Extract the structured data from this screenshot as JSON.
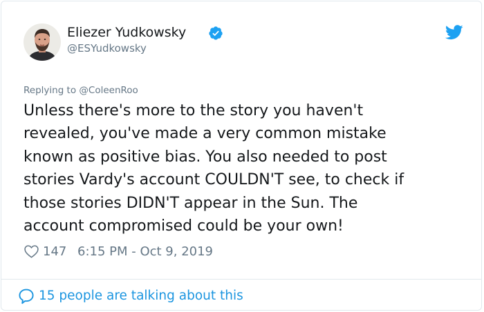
{
  "author": {
    "display_name": "Eliezer Yudkowsky",
    "handle": "@ESYudkowsky",
    "verified": true
  },
  "icons": {
    "avatar": "avatar-photo",
    "verified": "verified-badge-icon",
    "brand": "twitter-bird-icon",
    "like": "heart-icon",
    "conversation": "speech-bubble-icon"
  },
  "tweet": {
    "replying_to": "Replying to @ColeenRoo",
    "lines": [
      "Unless there's more to the story you haven't",
      "revealed, you've made a very common mistake",
      "known as positive bias.  You also needed to post",
      "stories Vardy's account COULDN'T see, to check if",
      "those stories DIDN'T appear in the Sun.  The",
      "account compromised could be your own!"
    ],
    "likes": "147",
    "timestamp": "6:15 PM - Oct 9, 2019"
  },
  "footer": {
    "talking": "15 people are talking about this"
  },
  "colors": {
    "brand_blue": "#1da1f2",
    "link_blue": "#1b95e0",
    "secondary_text": "#657786",
    "primary_text": "#14171a",
    "border": "#e1e8ed"
  }
}
